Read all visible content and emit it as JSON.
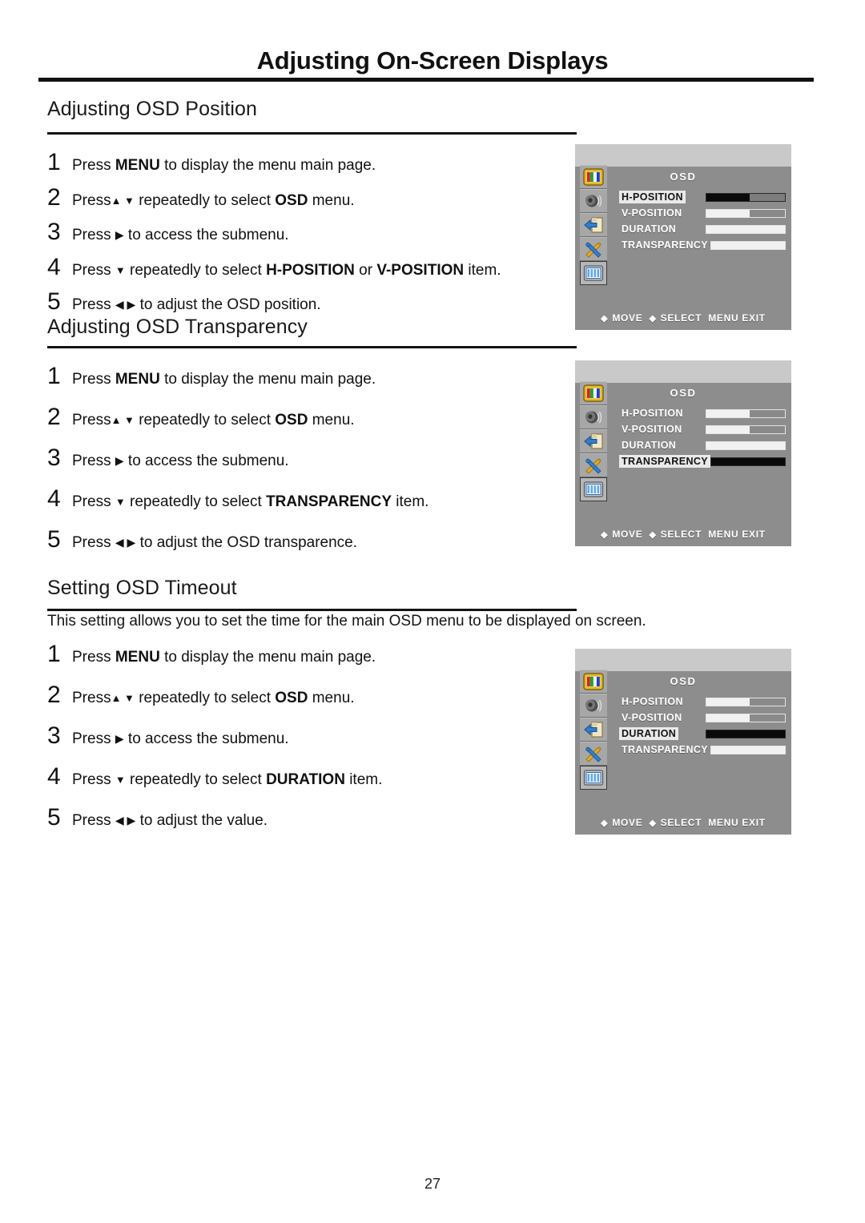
{
  "document": {
    "title": "Adjusting On-Screen Displays",
    "page_number": "27"
  },
  "sections": [
    {
      "heading": "Adjusting OSD Position",
      "intro": "",
      "steps": [
        {
          "num": "1",
          "pre": "Press ",
          "bold1": "MENU",
          "mid": " to display the menu main page.",
          "glyphs": "",
          "bold2": "",
          "post": ""
        },
        {
          "num": "2",
          "pre": "Press",
          "glyphs": "▲ ▼",
          "mid": " repeatedly to select ",
          "bold1": "OSD",
          "post": " menu."
        },
        {
          "num": "3",
          "pre": "Press ",
          "glyphs": "▶",
          "mid": " to access the submenu.",
          "bold1": "",
          "post": ""
        },
        {
          "num": "4",
          "pre": "Press ",
          "glyphs": "▼",
          "mid": " repeatedly to select ",
          "bold1": "H-POSITION",
          "joiner": " or ",
          "bold2": "V-POSITION",
          "post": " item."
        },
        {
          "num": "5",
          "pre": "Press ",
          "glyphs": "◀ ▶",
          "mid": " to adjust the OSD position.",
          "bold1": "",
          "post": ""
        }
      ]
    },
    {
      "heading": "Adjusting OSD Transparency",
      "intro": "",
      "steps": [
        {
          "num": "1",
          "pre": "Press ",
          "bold1": "MENU",
          "mid": " to display the menu main page.",
          "glyphs": "",
          "post": ""
        },
        {
          "num": "2",
          "pre": "Press",
          "glyphs": "▲ ▼",
          "mid": " repeatedly to select ",
          "bold1": "OSD",
          "post": " menu."
        },
        {
          "num": "3",
          "pre": "Press ",
          "glyphs": "▶",
          "mid": " to access the submenu.",
          "bold1": "",
          "post": ""
        },
        {
          "num": "4",
          "pre": "Press ",
          "glyphs": "▼",
          "mid": " repeatedly to select ",
          "bold1": "TRANSPARENCY",
          "post": " item."
        },
        {
          "num": "5",
          "pre": "Press ",
          "glyphs": "◀ ▶",
          "mid": " to adjust the OSD transparence.",
          "bold1": "",
          "post": ""
        }
      ]
    },
    {
      "heading": "Setting OSD Timeout",
      "intro": "This setting allows you to set the time for the main OSD menu to be displayed on screen.",
      "steps": [
        {
          "num": "1",
          "pre": "Press ",
          "bold1": "MENU",
          "mid": " to display the menu main page.",
          "glyphs": "",
          "post": ""
        },
        {
          "num": "2",
          "pre": "Press",
          "glyphs": "▲ ▼",
          "mid": " repeatedly to select ",
          "bold1": "OSD",
          "post": " menu."
        },
        {
          "num": "3",
          "pre": "Press ",
          "glyphs": "▶",
          "mid": " to access the submenu.",
          "bold1": "",
          "post": ""
        },
        {
          "num": "4",
          "pre": "Press ",
          "glyphs": "▼",
          "mid": " repeatedly to select ",
          "bold1": "DURATION",
          "post": " item."
        },
        {
          "num": "5",
          "pre": "Press ",
          "glyphs": "◀ ▶",
          "mid": " to adjust the value.",
          "bold1": "",
          "post": ""
        }
      ]
    }
  ],
  "osd_panels": [
    {
      "title": "OSD",
      "selected_icon_index": 4,
      "rows": [
        {
          "label": "H-POSITION",
          "highlighted": true,
          "bar_style": "dark",
          "fill_percent": 55
        },
        {
          "label": "V-POSITION",
          "highlighted": false,
          "bar_style": "light",
          "fill_percent": 55
        },
        {
          "label": "DURATION",
          "highlighted": false,
          "bar_style": "light",
          "fill_percent": 100
        },
        {
          "label": "TRANSPARENCY",
          "highlighted": false,
          "bar_style": "light",
          "fill_percent": 100
        }
      ],
      "footer": {
        "move": "MOVE",
        "select": "SELECT",
        "exit": "MENU EXIT",
        "diamond": "◆"
      }
    },
    {
      "title": "OSD",
      "selected_icon_index": 4,
      "rows": [
        {
          "label": "H-POSITION",
          "highlighted": false,
          "bar_style": "light",
          "fill_percent": 55
        },
        {
          "label": "V-POSITION",
          "highlighted": false,
          "bar_style": "light",
          "fill_percent": 55
        },
        {
          "label": "DURATION",
          "highlighted": false,
          "bar_style": "light",
          "fill_percent": 100
        },
        {
          "label": "TRANSPARENCY",
          "highlighted": true,
          "bar_style": "dark",
          "fill_percent": 100
        }
      ],
      "footer": {
        "move": "MOVE",
        "select": "SELECT",
        "exit": "MENU EXIT",
        "diamond": "◆"
      }
    },
    {
      "title": "OSD",
      "selected_icon_index": 4,
      "rows": [
        {
          "label": "H-POSITION",
          "highlighted": false,
          "bar_style": "light",
          "fill_percent": 55
        },
        {
          "label": "V-POSITION",
          "highlighted": false,
          "bar_style": "light",
          "fill_percent": 55
        },
        {
          "label": "DURATION",
          "highlighted": true,
          "bar_style": "dark",
          "fill_percent": 100
        },
        {
          "label": "TRANSPARENCY",
          "highlighted": false,
          "bar_style": "light",
          "fill_percent": 100
        }
      ],
      "footer": {
        "move": "MOVE",
        "select": "SELECT",
        "exit": "MENU EXIT",
        "diamond": "◆"
      }
    }
  ],
  "osd_icons": [
    {
      "name": "picture-color-bars-icon"
    },
    {
      "name": "speaker-audio-icon"
    },
    {
      "name": "input-source-icon"
    },
    {
      "name": "tools-setup-icon"
    },
    {
      "name": "osd-grid-icon"
    }
  ],
  "colors": {
    "osd_body": "#8d8d8d",
    "osd_top_strip": "#c9c9c9",
    "osd_highlight_bg": "#e9e9e9",
    "osd_text": "#ffffff",
    "rule": "#141414"
  }
}
